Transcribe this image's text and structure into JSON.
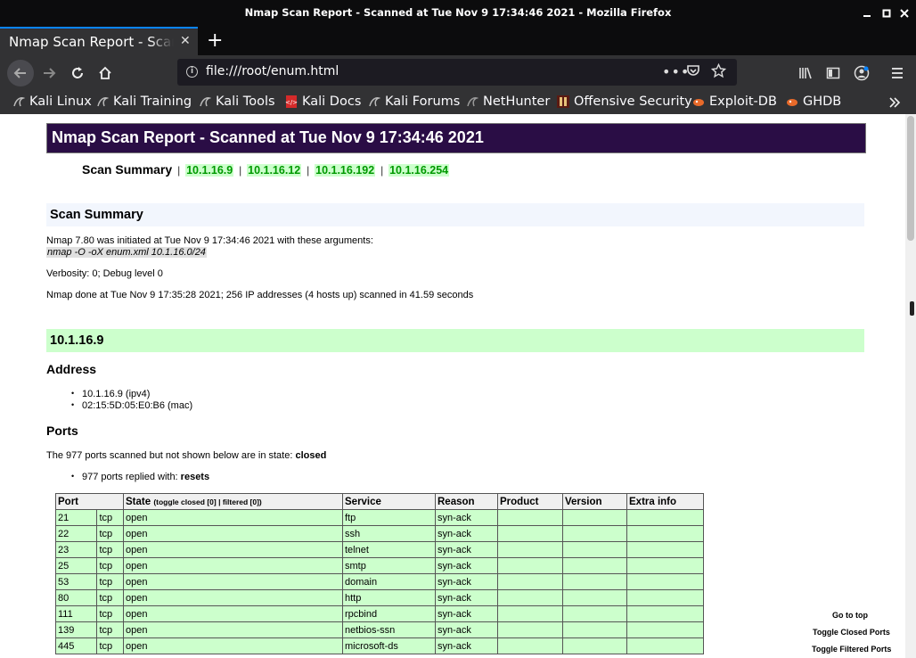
{
  "window": {
    "title": "Nmap Scan Report - Scanned at Tue Nov 9 17:34:46 2021 - Mozilla Firefox"
  },
  "tab": {
    "label": "Nmap Scan Report - Scanned at Tue Nov 9 17:34:46 2021",
    "close": "✕",
    "new": "+"
  },
  "urlbar": {
    "url": "file:///root/enum.html"
  },
  "bookmarks": [
    {
      "label": "Kali Linux",
      "icon": "kali-dragon-icon"
    },
    {
      "label": "Kali Training",
      "icon": "kali-dragon-icon"
    },
    {
      "label": "Kali Tools",
      "icon": "kali-dragon-icon"
    },
    {
      "label": "Kali Docs",
      "icon": "kali-docs-icon"
    },
    {
      "label": "Kali Forums",
      "icon": "kali-dragon-icon"
    },
    {
      "label": "NetHunter",
      "icon": "nethunter-icon"
    },
    {
      "label": "Offensive Security",
      "icon": "offsec-icon"
    },
    {
      "label": "Exploit-DB",
      "icon": "exploitdb-icon"
    },
    {
      "label": "GHDB",
      "icon": "ghdb-icon"
    }
  ],
  "report": {
    "title": "Nmap Scan Report - Scanned at Tue Nov 9 17:34:46 2021",
    "summary_label": "Scan Summary",
    "hosts": [
      "10.1.16.9",
      "10.1.16.12",
      "10.1.16.192",
      "10.1.16.254"
    ],
    "summary_heading": "Scan Summary",
    "initiated": "Nmap 7.80 was initiated at Tue Nov 9 17:34:46 2021 with these arguments:",
    "arguments": "nmap -O -oX enum.xml 10.1.16.0/24",
    "verbosity": "Verbosity: 0; Debug level 0",
    "done": "Nmap done at Tue Nov 9 17:35:28 2021; 256 IP addresses (4 hosts up) scanned in 41.59 seconds",
    "host_heading": "10.1.16.9",
    "address_heading": "Address",
    "addresses": [
      "10.1.16.9 (ipv4)",
      "02:15:5D:05:E0:B6 (mac)"
    ],
    "ports_heading": "Ports",
    "closed_text": "The 977 ports scanned but not shown below are in state: ",
    "closed_state": "closed",
    "replied_text": "977 ports replied with: ",
    "replied_reason": "resets",
    "table_headers": {
      "port": "Port",
      "state": "State",
      "state_toggle_open": "(toggle ",
      "state_toggle_closed": "closed [0]",
      "state_toggle_sep": " | ",
      "state_toggle_filtered": "filtered [0]",
      "state_toggle_close": ")",
      "service": "Service",
      "reason": "Reason",
      "product": "Product",
      "version": "Version",
      "extra": "Extra info"
    },
    "ports": [
      {
        "port": "21",
        "proto": "tcp",
        "state": "open",
        "service": "ftp",
        "reason": "syn-ack"
      },
      {
        "port": "22",
        "proto": "tcp",
        "state": "open",
        "service": "ssh",
        "reason": "syn-ack"
      },
      {
        "port": "23",
        "proto": "tcp",
        "state": "open",
        "service": "telnet",
        "reason": "syn-ack"
      },
      {
        "port": "25",
        "proto": "tcp",
        "state": "open",
        "service": "smtp",
        "reason": "syn-ack"
      },
      {
        "port": "53",
        "proto": "tcp",
        "state": "open",
        "service": "domain",
        "reason": "syn-ack"
      },
      {
        "port": "80",
        "proto": "tcp",
        "state": "open",
        "service": "http",
        "reason": "syn-ack"
      },
      {
        "port": "111",
        "proto": "tcp",
        "state": "open",
        "service": "rpcbind",
        "reason": "syn-ack"
      },
      {
        "port": "139",
        "proto": "tcp",
        "state": "open",
        "service": "netbios-ssn",
        "reason": "syn-ack"
      },
      {
        "port": "445",
        "proto": "tcp",
        "state": "open",
        "service": "microsoft-ds",
        "reason": "syn-ack"
      }
    ],
    "float_links": {
      "top": "Go to top",
      "closed": "Toggle Closed Ports",
      "filtered": "Toggle Filtered Ports"
    }
  }
}
